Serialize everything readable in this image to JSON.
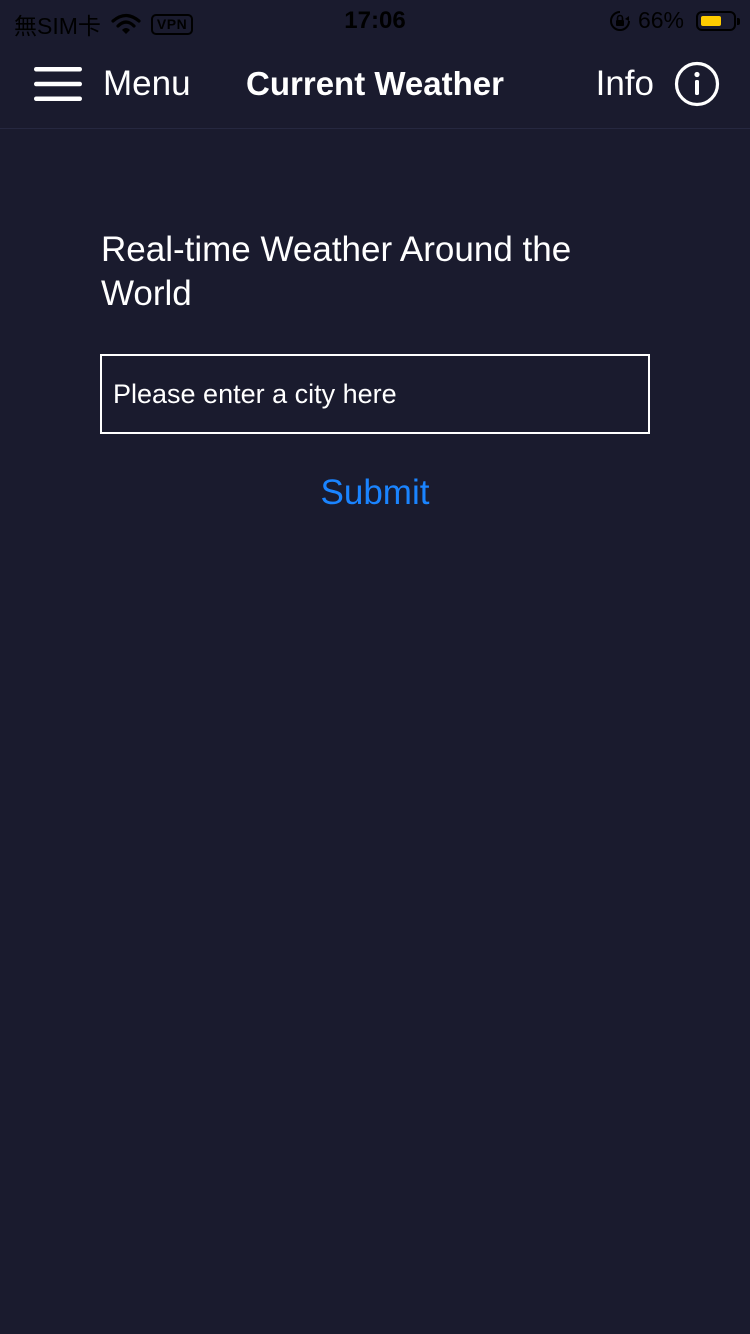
{
  "status_bar": {
    "carrier": "無SIM卡",
    "vpn": "VPN",
    "time": "17:06",
    "battery_percent": "66%",
    "battery_level": 0.66,
    "battery_color": "#ffcc00"
  },
  "nav": {
    "menu_label": "Menu",
    "title": "Current Weather",
    "info_label": "Info"
  },
  "main": {
    "heading": "Real-time Weather Around the World",
    "city_input": {
      "value": "",
      "placeholder": "Please enter a city here"
    },
    "submit_label": "Submit"
  },
  "colors": {
    "background": "#1a1b2e",
    "accent": "#1a84ff",
    "text": "#ffffff"
  },
  "icons": {
    "menu": "hamburger-menu-icon",
    "info": "info-circle-icon",
    "wifi": "wifi-icon",
    "orientation_lock": "orientation-lock-icon",
    "battery": "battery-icon"
  }
}
